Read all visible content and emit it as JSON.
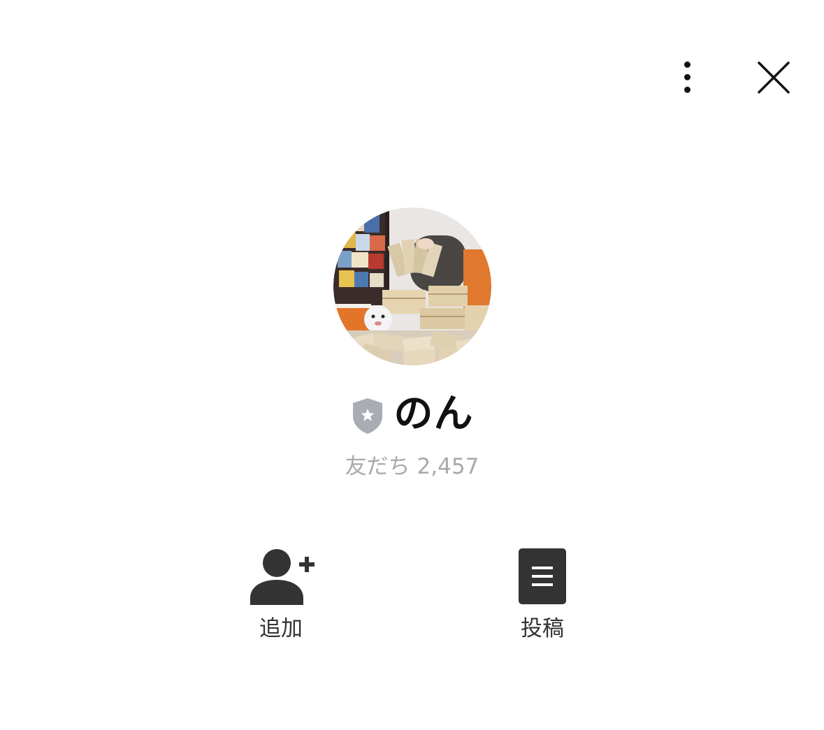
{
  "header": {
    "more_icon": "vertical-ellipsis-icon",
    "close_icon": "close-x-icon"
  },
  "profile": {
    "avatar_description_icon": "profile-photo",
    "badge_icon": "gray-shield-star-icon",
    "name": "のん",
    "friends_label": "友だち",
    "friends_count": "2,457"
  },
  "actions": [
    {
      "label": "追加",
      "icon": "add-friend-icon"
    },
    {
      "label": "投稿",
      "icon": "post-document-icon"
    }
  ],
  "colors": {
    "background": "#ffffff",
    "icon_dark": "#333333",
    "subtext": "#a9a9a9",
    "badge": "#a9adb3"
  }
}
